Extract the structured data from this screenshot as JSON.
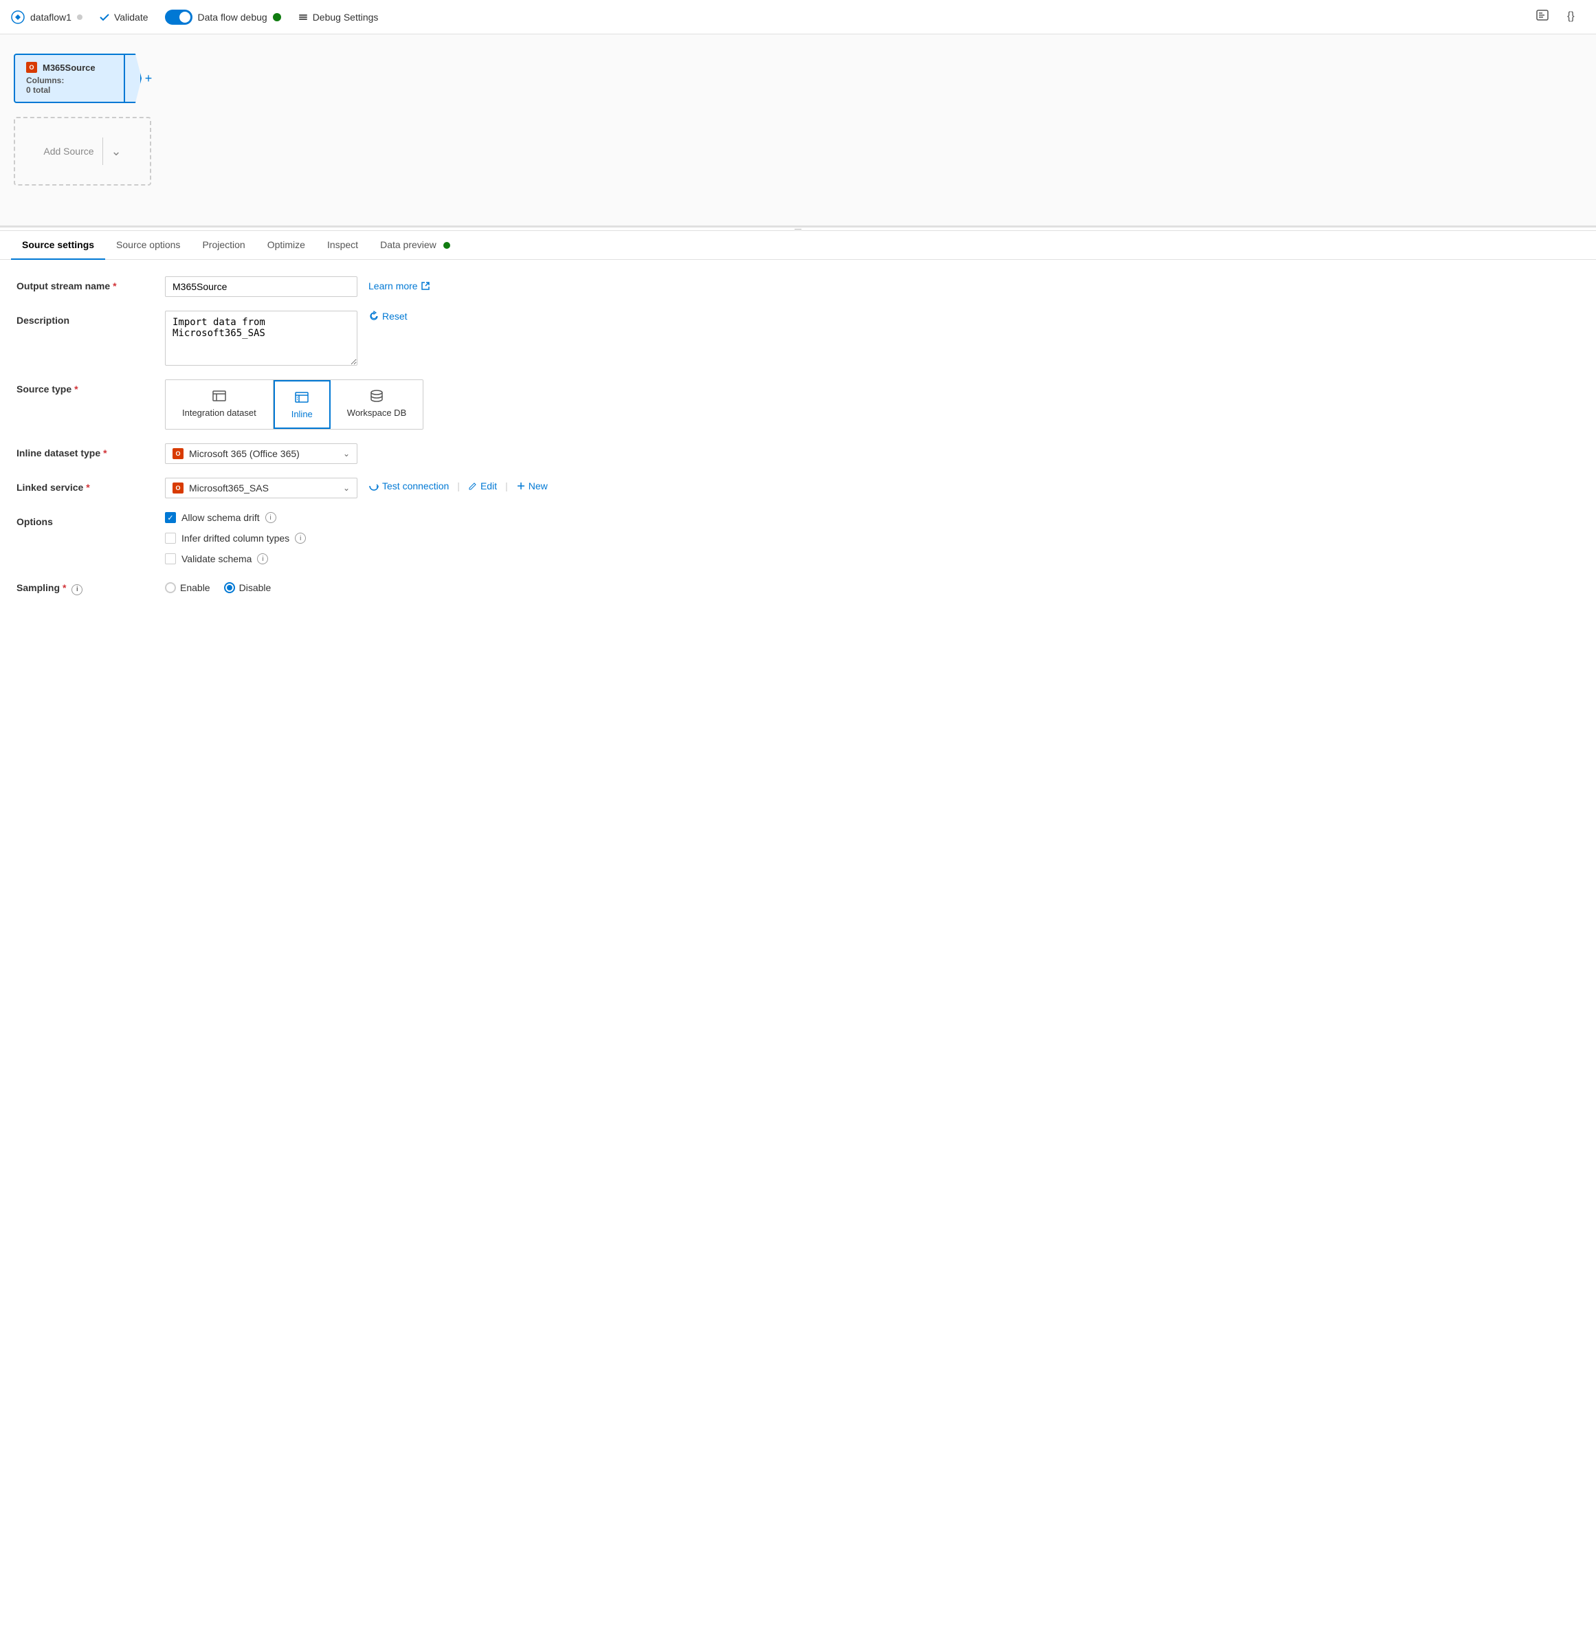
{
  "app": {
    "title": "dataflow1",
    "dot_color": "#ccc"
  },
  "toolbar": {
    "validate_label": "Validate",
    "debug_label": "Data flow debug",
    "debug_settings_label": "Debug Settings"
  },
  "canvas": {
    "node": {
      "name": "M365Source",
      "columns_label": "Columns:",
      "columns_value": "0 total"
    },
    "add_source_label": "Add Source"
  },
  "tabs": [
    {
      "id": "source-settings",
      "label": "Source settings",
      "active": true
    },
    {
      "id": "source-options",
      "label": "Source options",
      "active": false
    },
    {
      "id": "projection",
      "label": "Projection",
      "active": false
    },
    {
      "id": "optimize",
      "label": "Optimize",
      "active": false
    },
    {
      "id": "inspect",
      "label": "Inspect",
      "active": false
    },
    {
      "id": "data-preview",
      "label": "Data preview",
      "active": false,
      "has_dot": true
    }
  ],
  "form": {
    "output_stream_name": {
      "label": "Output stream name",
      "required": true,
      "value": "M365Source",
      "learn_more_label": "Learn more"
    },
    "description": {
      "label": "Description",
      "required": false,
      "value": "Import data from Microsoft365_SAS",
      "reset_label": "Reset"
    },
    "source_type": {
      "label": "Source type",
      "required": true,
      "options": [
        {
          "id": "integration-dataset",
          "label": "Integration dataset",
          "active": false
        },
        {
          "id": "inline",
          "label": "Inline",
          "active": true
        },
        {
          "id": "workspace-db",
          "label": "Workspace DB",
          "active": false
        }
      ]
    },
    "inline_dataset_type": {
      "label": "Inline dataset type",
      "required": true,
      "value": "Microsoft 365 (Office 365)"
    },
    "linked_service": {
      "label": "Linked service",
      "required": true,
      "value": "Microsoft365_SAS",
      "test_connection_label": "Test connection",
      "edit_label": "Edit",
      "new_label": "New"
    },
    "options": {
      "label": "Options",
      "items": [
        {
          "id": "allow-schema-drift",
          "label": "Allow schema drift",
          "checked": true
        },
        {
          "id": "infer-drifted-column-types",
          "label": "Infer drifted column types",
          "checked": false
        },
        {
          "id": "validate-schema",
          "label": "Validate schema",
          "checked": false
        }
      ]
    },
    "sampling": {
      "label": "Sampling",
      "required": true,
      "options": [
        {
          "id": "enable",
          "label": "Enable",
          "selected": false
        },
        {
          "id": "disable",
          "label": "Disable",
          "selected": true
        }
      ]
    }
  }
}
